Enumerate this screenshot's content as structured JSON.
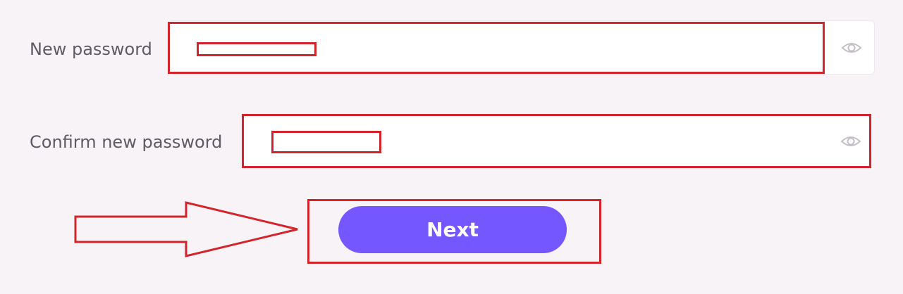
{
  "form": {
    "new_password": {
      "label": "New password",
      "value": "",
      "icon": "eye-icon"
    },
    "confirm_password": {
      "label": "Confirm new password",
      "value": "",
      "icon": "eye-icon"
    },
    "next_label": "Next"
  },
  "colors": {
    "background": "#f7f3f7",
    "label": "#5f5a64",
    "button": "#7557ff",
    "annotation": "#d3242c"
  }
}
